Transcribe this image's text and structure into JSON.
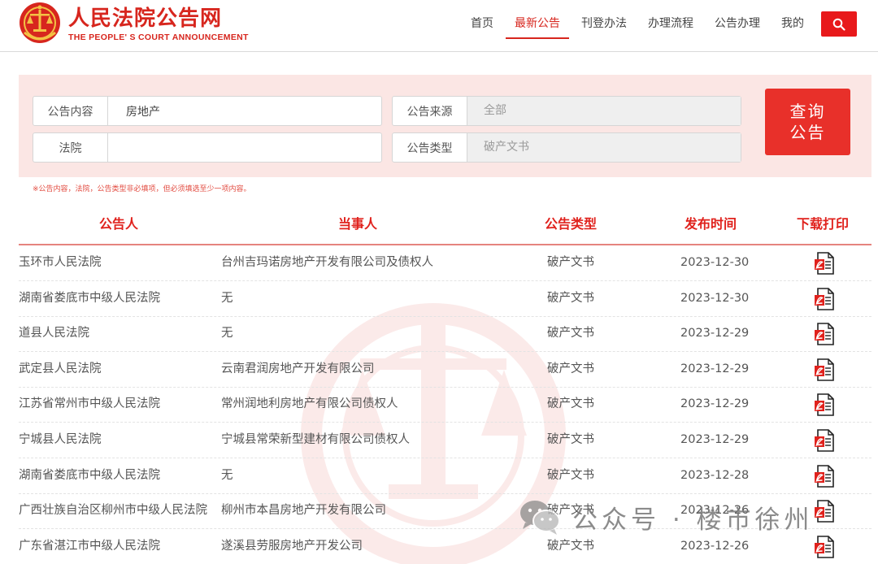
{
  "header": {
    "title": "人民法院公告网",
    "subtitle": "THE PEOPLE' S COURT ANNOUNCEMENT",
    "nav": [
      "首页",
      "最新公告",
      "刊登办法",
      "办理流程",
      "公告办理",
      "我的"
    ],
    "active_nav": 1,
    "search_icon": "search-icon"
  },
  "search": {
    "content_label": "公告内容",
    "content_value": "房地产",
    "source_label": "公告来源",
    "source_value": "全部",
    "court_label": "法院",
    "court_value": "",
    "type_label": "公告类型",
    "type_value": "破产文书",
    "button_line1": "查询",
    "button_line2": "公告",
    "notice": "※公告内容，法院，公告类型非必填项，但必须填选至少一项内容。"
  },
  "table": {
    "headers": [
      "公告人",
      "当事人",
      "公告类型",
      "发布时间",
      "下载打印"
    ],
    "rows": [
      {
        "court": "玉环市人民法院",
        "party": "台州吉玛诺房地产开发有限公司及债权人",
        "type": "破产文书",
        "date": "2023-12-30"
      },
      {
        "court": "湖南省娄底市中级人民法院",
        "party": "无",
        "type": "破产文书",
        "date": "2023-12-30"
      },
      {
        "court": "道县人民法院",
        "party": "无",
        "type": "破产文书",
        "date": "2023-12-29"
      },
      {
        "court": "武定县人民法院",
        "party": "云南君润房地产开发有限公司",
        "type": "破产文书",
        "date": "2023-12-29"
      },
      {
        "court": "江苏省常州市中级人民法院",
        "party": "常州润地利房地产有限公司债权人",
        "type": "破产文书",
        "date": "2023-12-29"
      },
      {
        "court": "宁城县人民法院",
        "party": "宁城县常荣新型建材有限公司债权人",
        "type": "破产文书",
        "date": "2023-12-29"
      },
      {
        "court": "湖南省娄底市中级人民法院",
        "party": "无",
        "type": "破产文书",
        "date": "2023-12-28"
      },
      {
        "court": "广西壮族自治区柳州市中级人民法院",
        "party": "柳州市本昌房地产开发有限公司",
        "type": "破产文书",
        "date": "2023-12-26"
      },
      {
        "court": "广东省湛江市中级人民法院",
        "party": "遂溪县劳服房地产开发公司",
        "type": "破产文书",
        "date": "2023-12-26"
      }
    ],
    "pdf_icon": "pdf-icon"
  },
  "overlay": {
    "wechat_text": "公众号 · 楼市徐州",
    "wechat_icon": "wechat-icon"
  },
  "colors": {
    "brand_red": "#d7261e",
    "button_red": "#e8302a",
    "panel_bg": "#fbe6e4"
  }
}
